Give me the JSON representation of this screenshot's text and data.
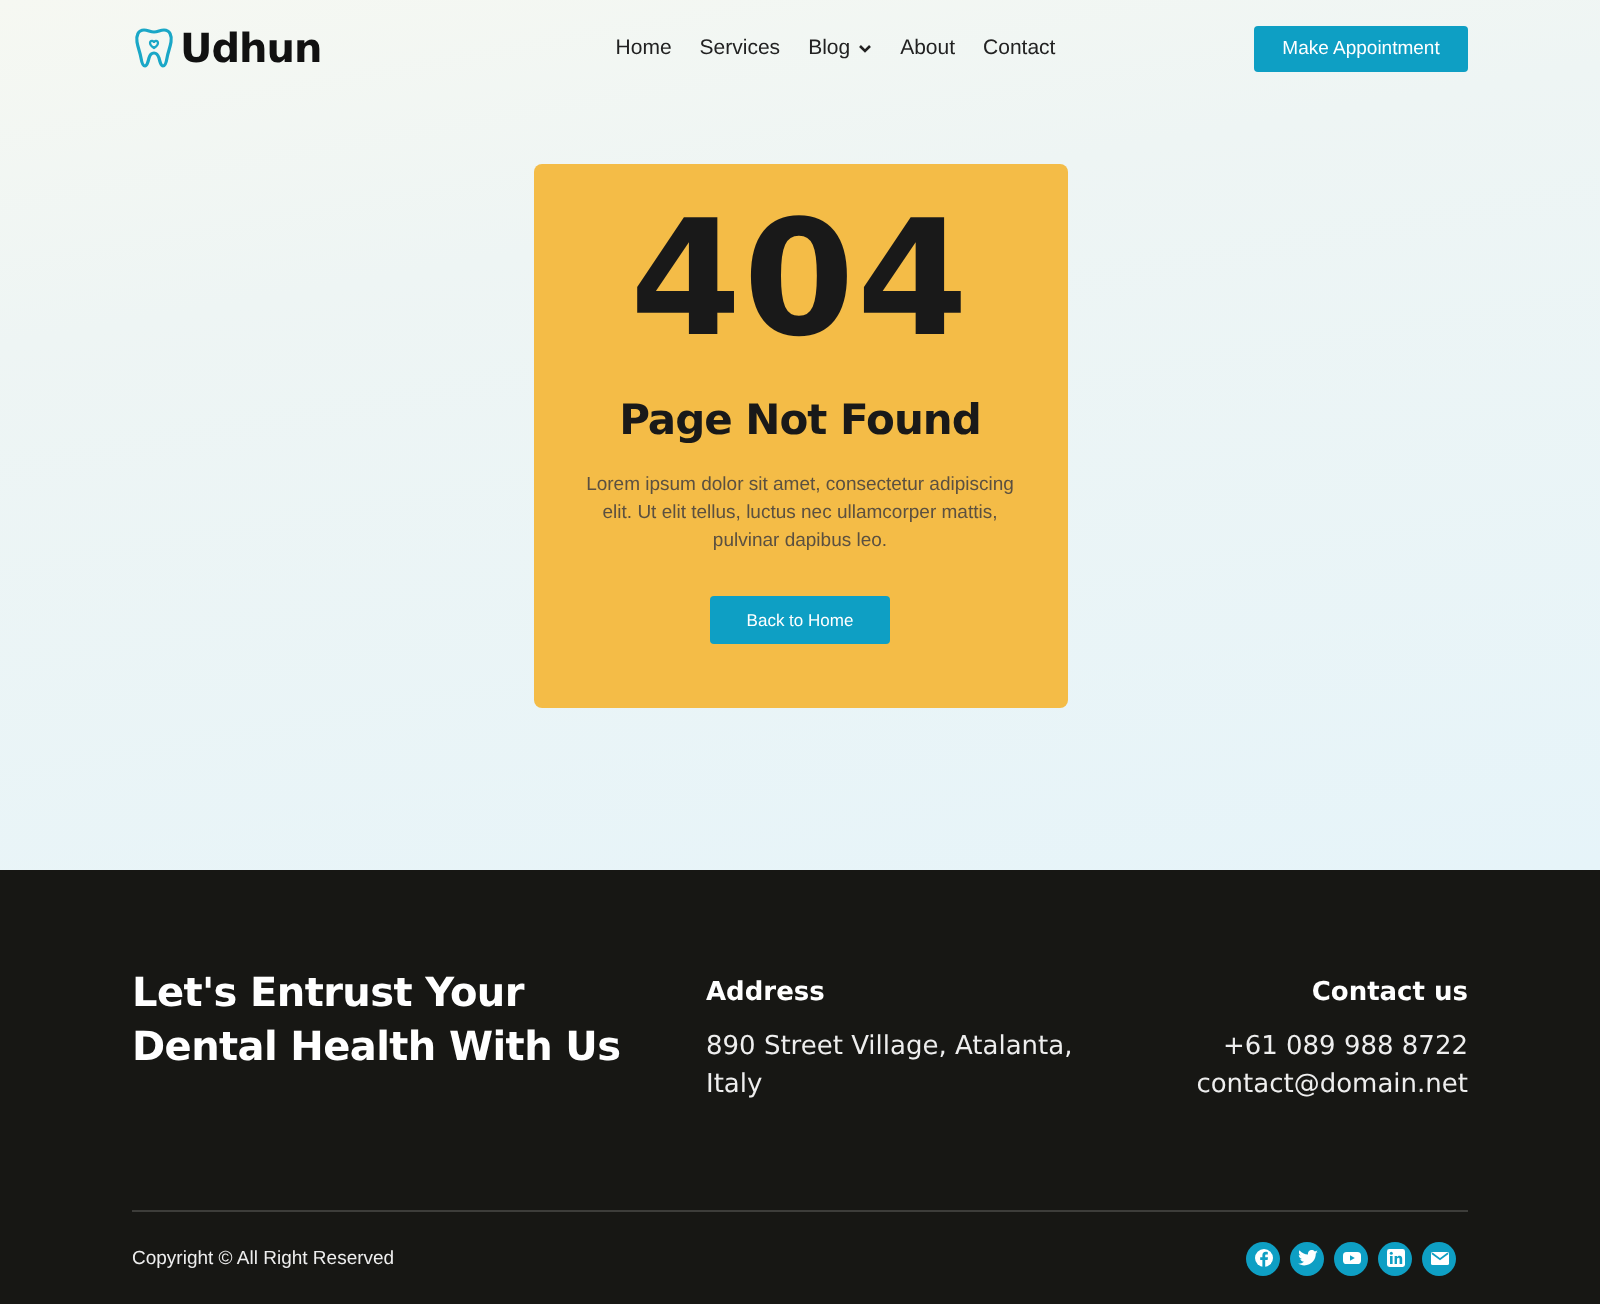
{
  "header": {
    "logo": "Udhun",
    "nav": [
      {
        "label": "Home",
        "dropdown": false
      },
      {
        "label": "Services",
        "dropdown": false
      },
      {
        "label": "Blog",
        "dropdown": true
      },
      {
        "label": "About",
        "dropdown": false
      },
      {
        "label": "Contact",
        "dropdown": false
      }
    ],
    "cta": "Make Appointment"
  },
  "error_card": {
    "code": "404",
    "title": "Page Not Found",
    "text": "Lorem ipsum dolor sit amet, consectetur adipiscing elit. Ut elit tellus, luctus nec ullamcorper mattis, pulvinar dapibus leo.",
    "button": "Back to Home"
  },
  "footer": {
    "tagline": "Let's Entrust Your Dental Health With Us",
    "address_title": "Address",
    "address": "890 Street Village, Atalanta, Italy",
    "contact_title": "Contact us",
    "phone": "+61 089 988 8722",
    "email": "contact@domain.net",
    "copyright": "Copyright © All Right Reserved",
    "social": [
      {
        "kind": "facebook"
      },
      {
        "kind": "twitter"
      },
      {
        "kind": "youtube"
      },
      {
        "kind": "linkedin"
      },
      {
        "kind": "email"
      }
    ]
  }
}
